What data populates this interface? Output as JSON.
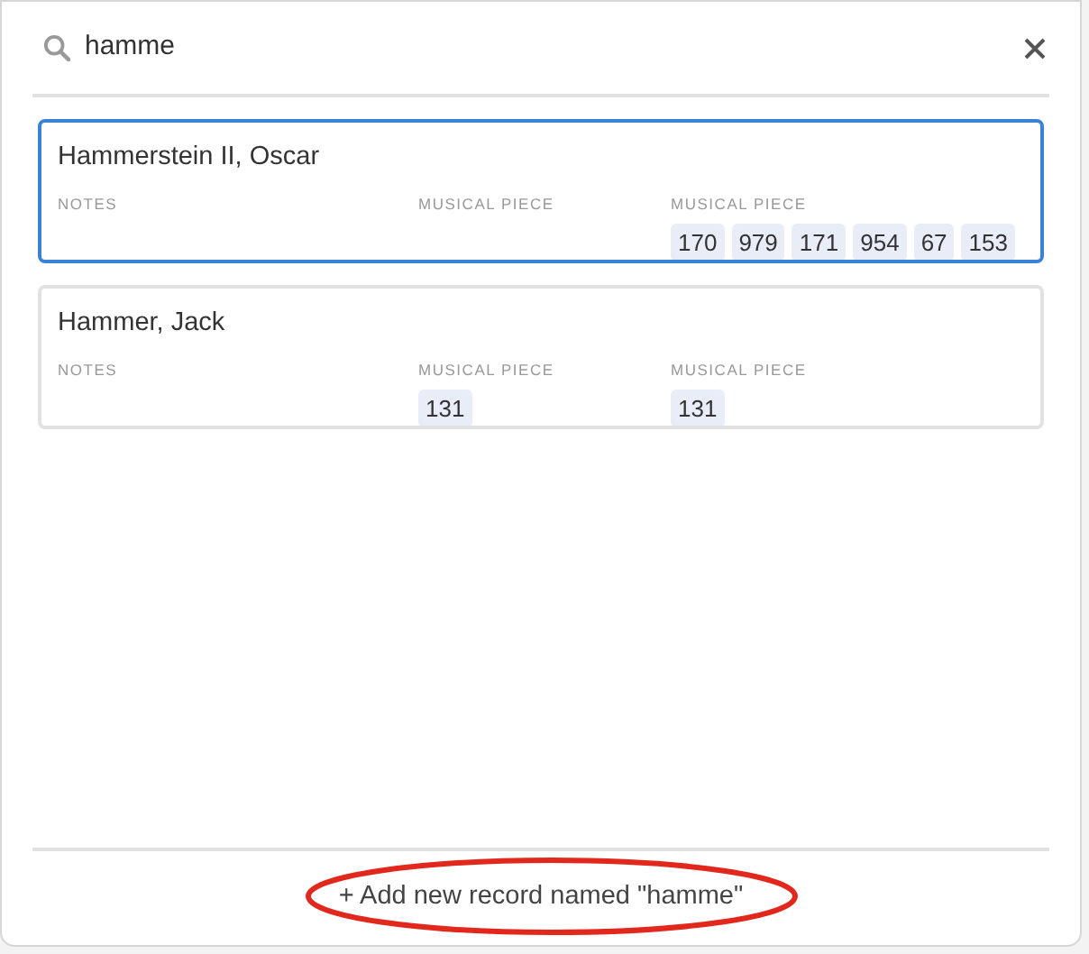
{
  "search": {
    "value": "hamme"
  },
  "records": [
    {
      "name": "Hammerstein II, Oscar",
      "selected": true,
      "fields": [
        {
          "label": "NOTES"
        },
        {
          "label": "MUSICAL PIECE"
        },
        {
          "label": "MUSICAL PIECE",
          "chips": [
            "170",
            "979",
            "171",
            "954",
            "67",
            "153"
          ]
        }
      ]
    },
    {
      "name": "Hammer, Jack",
      "selected": false,
      "fields": [
        {
          "label": "NOTES"
        },
        {
          "label": "MUSICAL PIECE",
          "chips": [
            "131"
          ]
        },
        {
          "label": "MUSICAL PIECE",
          "chips": [
            "131"
          ]
        }
      ]
    }
  ],
  "add_button": {
    "icon": "+",
    "label": "Add new record named \"hamme\""
  },
  "annotation": {
    "kind": "ellipse",
    "color": "#e2281c"
  }
}
